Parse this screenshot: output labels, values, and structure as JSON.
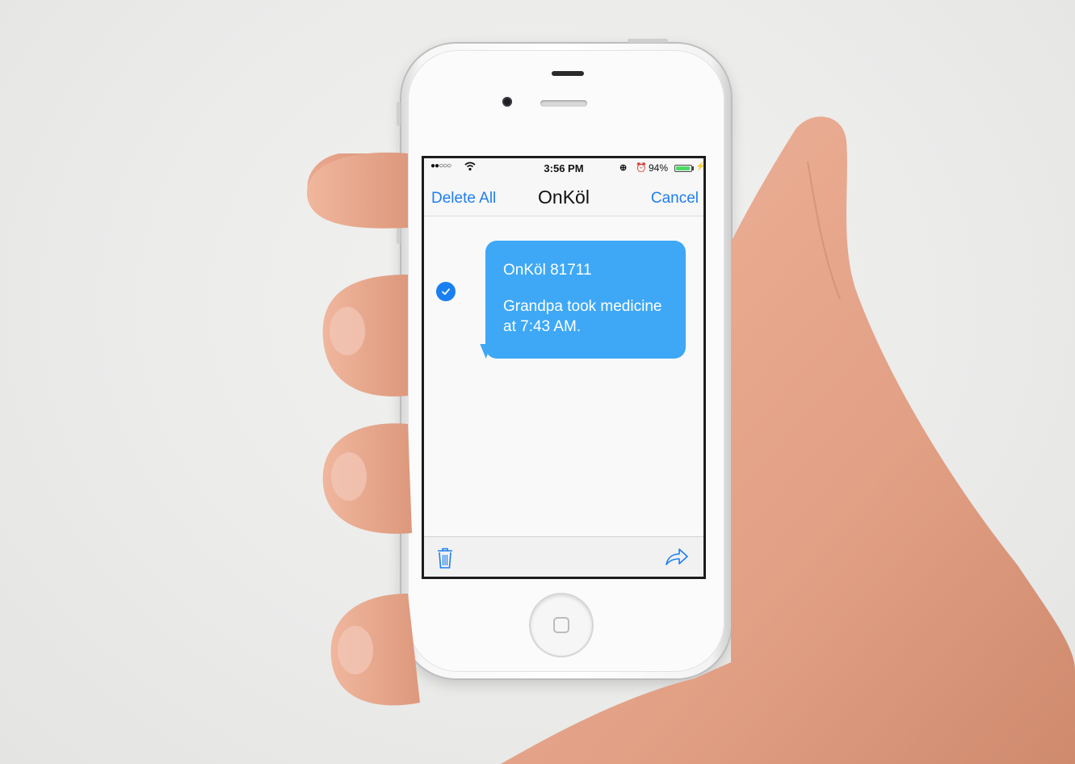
{
  "status_bar": {
    "signal": "●●○○○",
    "time": "3:56 PM",
    "battery_percent": "94%",
    "battery_level": 0.94
  },
  "nav": {
    "left_label": "Delete All",
    "title": "OnKöl",
    "right_label": "Cancel"
  },
  "message": {
    "selected": true,
    "lines": [
      "OnKöl 81711",
      "Grandpa took medicine",
      "at 7:43 AM."
    ]
  },
  "toolbar": {
    "left_icon": "trash-icon",
    "right_icon": "forward-icon"
  },
  "colors": {
    "accent": "#1e7ef0",
    "bubble": "#3ea8f6",
    "battery": "#4cd964"
  }
}
